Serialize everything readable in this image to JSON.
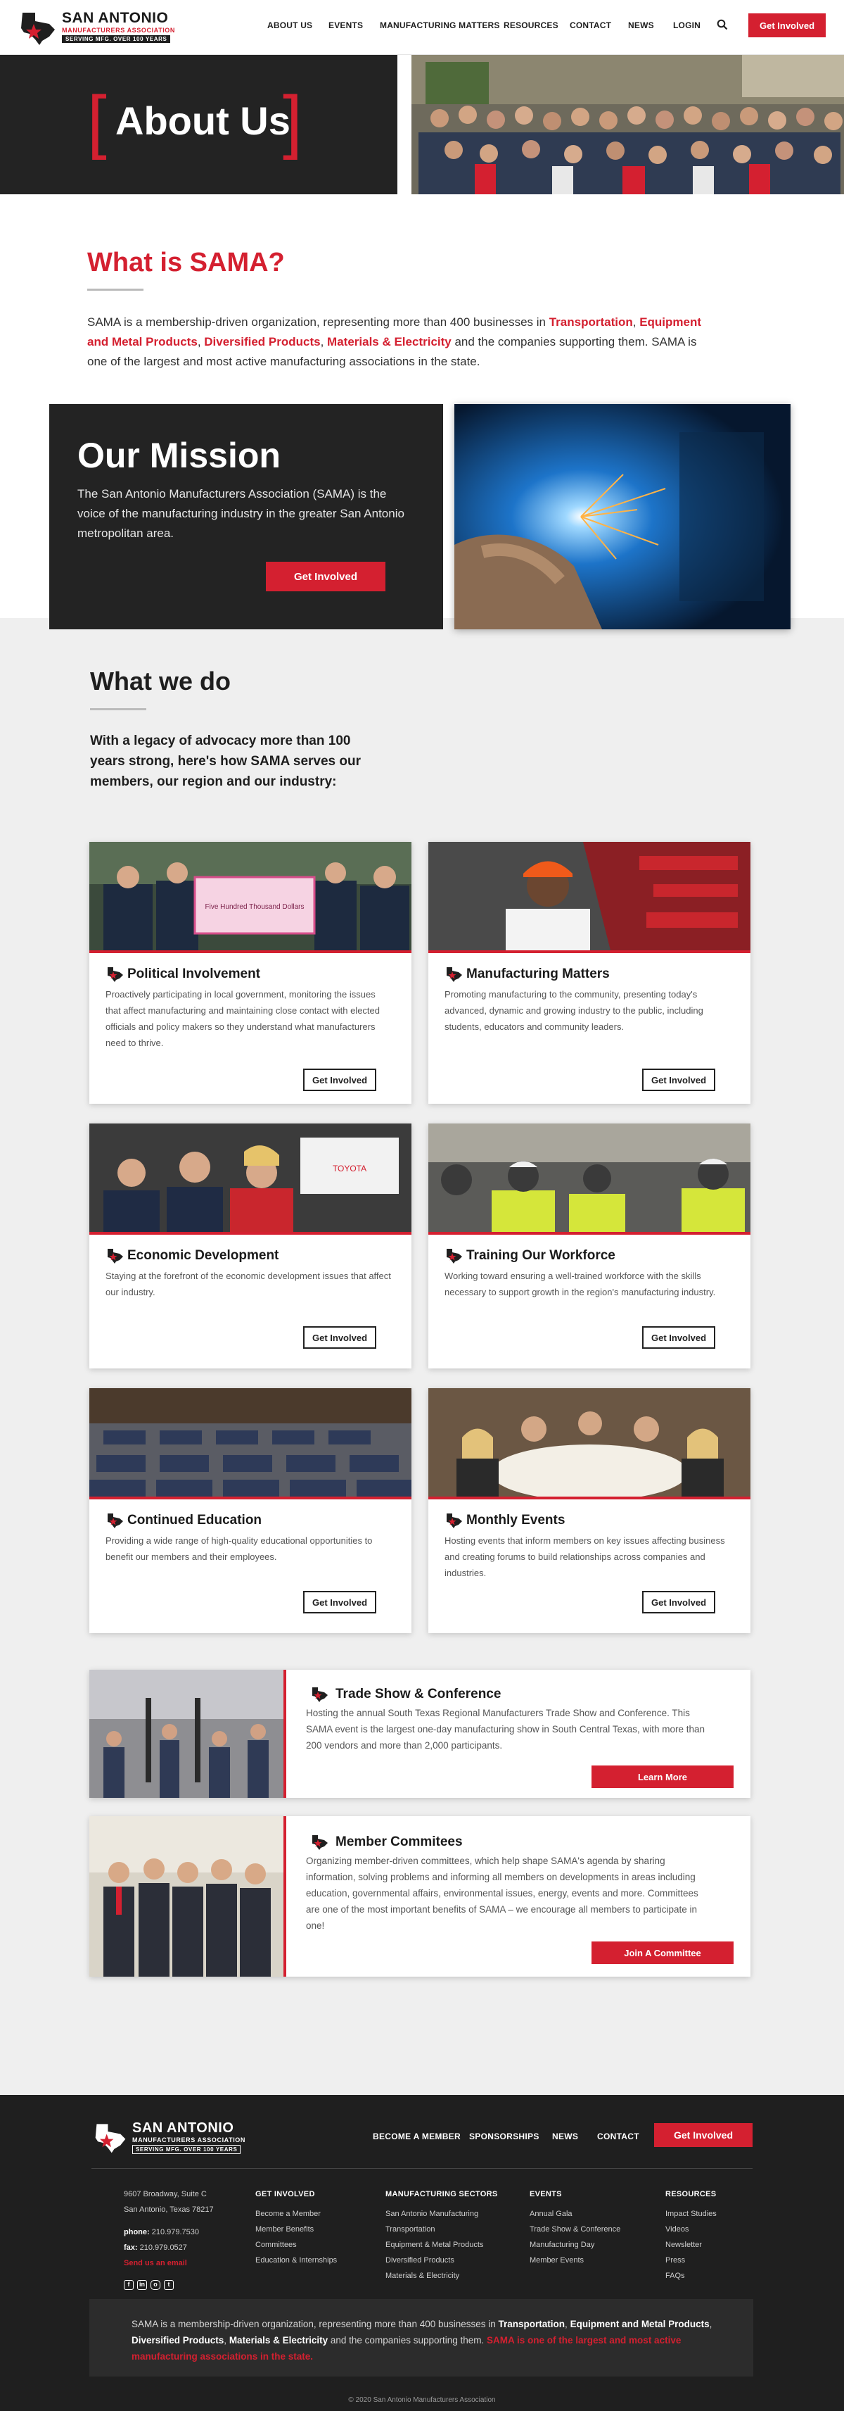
{
  "header": {
    "logo": {
      "name": "SAN ANTONIO",
      "subtitle": "MANUFACTURERS ASSOCIATION",
      "tagline": "SERVING MFG. OVER 100 YEARS"
    },
    "nav": [
      "ABOUT US",
      "EVENTS",
      "MANUFACTURING MATTERS",
      "RESOURCES",
      "CONTACT",
      "NEWS",
      "LOGIN"
    ],
    "cta": "Get Involved",
    "search_icon": "search-icon"
  },
  "hero": {
    "title": "About Us",
    "bracket_left": "[",
    "bracket_right": "]"
  },
  "what_is": {
    "title": "What is SAMA?",
    "p1": "SAMA is a membership-driven organization, representing more than 400 businesses in ",
    "h1": "Transportation",
    "p2": ", ",
    "h2": "Equipment and Metal Products",
    "p3": ", ",
    "h3": "Diversified Products",
    "p4": ", ",
    "h4": "Materials & Electricity",
    "p5": " and the companies supporting them. SAMA is one of the largest and most active manufacturing associations in the state."
  },
  "mission": {
    "title": "Our Mission",
    "text": "The San Antonio Manufacturers Association (SAMA) is the voice of the manufacturing industry in the greater San Antonio metropolitan area.",
    "button": "Get Involved"
  },
  "what_we_do": {
    "title": "What we do",
    "intro": "With a legacy of advocacy more than 100 years strong, here's how SAMA serves our members, our region and our industry:"
  },
  "cards": [
    {
      "title": "Political Involvement",
      "desc": "Proactively participating in local government, monitoring the issues that affect manufacturing and maintaining close contact with elected officials and policy makers so they understand what manufacturers need to thrive.",
      "button": "Get Involved"
    },
    {
      "title": "Manufacturing Matters",
      "desc": "Promoting manufacturing to the community, presenting today's advanced, dynamic and growing industry to the public, including students, educators and community leaders.",
      "button": "Get Involved"
    },
    {
      "title": "Economic Development",
      "desc": "Staying at the forefront of the economic development issues that affect our industry.",
      "button": "Get Involved"
    },
    {
      "title": "Training Our Workforce",
      "desc": "Working toward ensuring a well-trained workforce with the skills necessary to support growth in the region's manufacturing industry.",
      "button": "Get Involved"
    },
    {
      "title": "Continued Education",
      "desc": "Providing a wide range of high-quality educational opportunities to benefit our members and their employees.",
      "button": "Get Involved"
    },
    {
      "title": "Monthly Events",
      "desc": "Hosting events that inform members on key issues affecting business and creating forums to build relationships across companies and industries.",
      "button": "Get Involved"
    }
  ],
  "wide_cards": [
    {
      "title": "Trade Show & Conference",
      "desc": "Hosting the annual South Texas Regional Manufacturers Trade Show and Conference. This SAMA event is the largest one-day manufacturing show in South Central Texas, with more than 200 vendors and more than 2,000 participants.",
      "button": "Learn More"
    },
    {
      "title": "Member Commitees",
      "desc": "Organizing member-driven committees, which help shape SAMA's agenda by sharing information, solving problems and informing all members on developments in areas including education, governmental affairs, environmental issues, energy, events and more. Committees are one of the most important benefits of SAMA – we encourage all members to participate in one!",
      "button": "Join A Committee"
    }
  ],
  "photos": {
    "toyota_sign": "TOYOTA",
    "check_to": "Five Hundred Thousand Dollars"
  },
  "footer": {
    "nav": [
      "BECOME A MEMBER",
      "SPONSORSHIPS",
      "NEWS",
      "CONTACT"
    ],
    "cta": "Get Involved",
    "address1": "9607 Broadway, Suite C",
    "address2": "San Antonio, Texas 78217",
    "phone_label": "phone:",
    "phone": "210.979.7530",
    "fax_label": "fax:",
    "fax": "210.979.0527",
    "email": "Send us an email",
    "columns": [
      {
        "heading": "GET INVOLVED",
        "items": [
          "Become a Member",
          "Member Benefits",
          "Committees",
          "Education & Internships"
        ]
      },
      {
        "heading": "MANUFACTURING SECTORS",
        "items": [
          "San Antonio Manufacturing",
          "Transportation",
          "Equipment & Metal Products",
          "Diversified Products",
          "Materials & Electricity"
        ]
      },
      {
        "heading": "EVENTS",
        "items": [
          "Annual Gala",
          "Trade Show & Conference",
          "Manufacturing Day",
          "Member Events"
        ]
      },
      {
        "heading": "RESOURCES",
        "items": [
          "Impact Studies",
          "Videos",
          "Newsletter",
          "Press",
          "FAQs"
        ]
      }
    ],
    "about": {
      "p1": "SAMA is a membership-driven organization, representing more than 400 businesses in ",
      "b1": "Transportation",
      "p2": ", ",
      "b2": "Equipment and Metal Products",
      "p3": ", ",
      "b3": "Diversified Products",
      "p4": ", ",
      "b4": "Materials & Electricity",
      "p5": " and the companies supporting them. ",
      "r1": "SAMA is one of the largest and most active manufacturing associations in the state."
    },
    "copyright": "© 2020 San Antonio Manufacturers Association"
  },
  "colors": {
    "accent": "#d42030",
    "dark": "#232323",
    "grey_bg": "#efefef"
  }
}
